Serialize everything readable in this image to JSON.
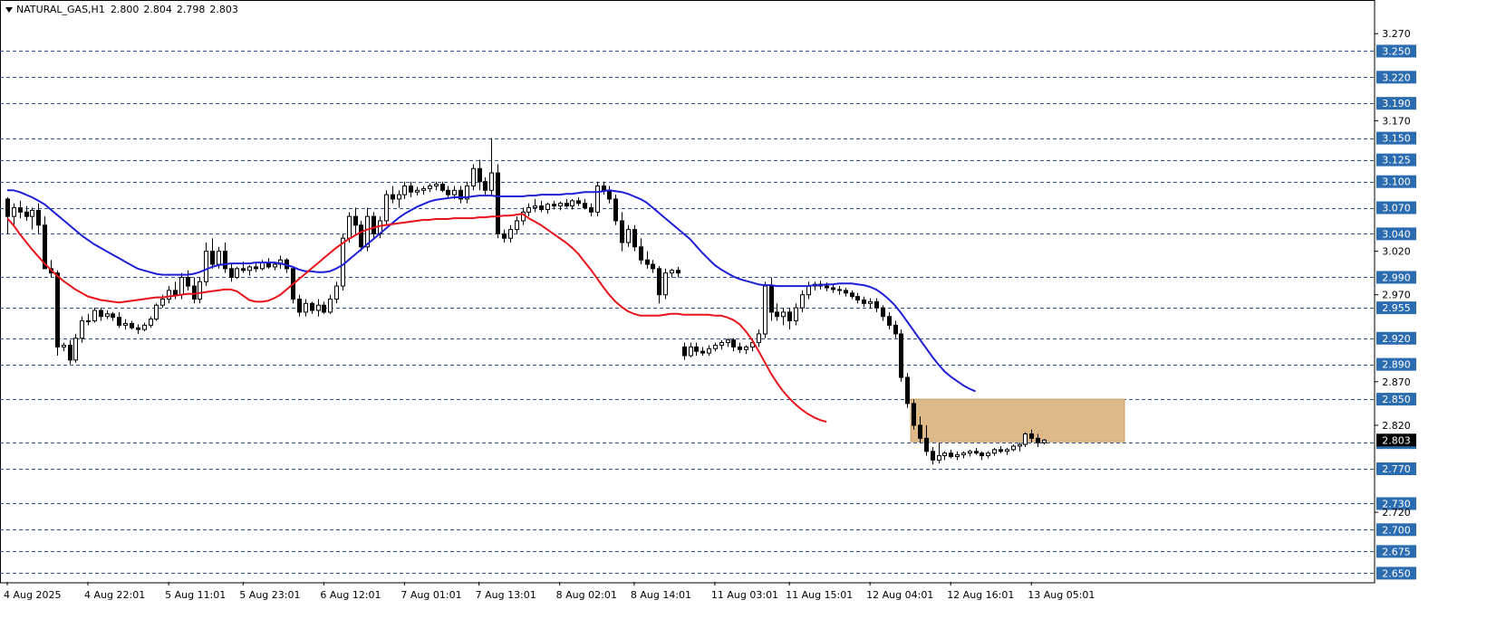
{
  "header": {
    "symbol": "NATURAL_GAS,H1",
    "open": "2.800",
    "high": "2.804",
    "low": "2.798",
    "close": "2.803"
  },
  "colors": {
    "background": "#ffffff",
    "grid": "#2f5597",
    "level_box": "#2b6cb0",
    "level_text": "#ffffff",
    "ma_fast": "#1f1fd6",
    "ma_slow": "#e8131b",
    "zone": "#ddb98a",
    "candle": "#000000",
    "axis_text": "#000000"
  },
  "chart_data": {
    "type": "candlestick",
    "instrument": "NATURAL_GAS",
    "timeframe": "H1",
    "ylim": [
      2.64,
      3.29
    ],
    "y_ticks": [
      "3.270",
      "3.250",
      "3.220",
      "3.190",
      "3.170",
      "3.150",
      "3.125",
      "3.100",
      "3.070",
      "3.040",
      "3.020",
      "2.990",
      "2.970",
      "2.955",
      "2.920",
      "2.890",
      "2.870",
      "2.850",
      "2.820",
      "2.800",
      "2.770",
      "2.730",
      "2.720",
      "2.700",
      "2.675",
      "2.650"
    ],
    "horizontal_levels": [
      "3.250",
      "3.220",
      "3.190",
      "3.150",
      "3.125",
      "3.100",
      "3.070",
      "3.040",
      "2.990",
      "2.955",
      "2.920",
      "2.890",
      "2.850",
      "2.800",
      "2.770",
      "2.730",
      "2.700",
      "2.675",
      "2.650"
    ],
    "current_price": "2.803",
    "x_labels": [
      "4 Aug 2025",
      "4 Aug 22:01",
      "5 Aug 11:01",
      "5 Aug 23:01",
      "6 Aug 12:01",
      "7 Aug 01:01",
      "7 Aug 13:01",
      "8 Aug 02:01",
      "8 Aug 14:01",
      "11 Aug 03:01",
      "11 Aug 15:01",
      "12 Aug 04:01",
      "12 Aug 16:01",
      "13 Aug 05:01"
    ],
    "x_label_candle_index": [
      0,
      13,
      26,
      38,
      51,
      64,
      76,
      89,
      101,
      114,
      126,
      139,
      152,
      165
    ],
    "zone": {
      "y_top": 2.85,
      "y_bottom": 2.801,
      "x_start_index": 146,
      "x_end_index": 180
    },
    "candles": [
      [
        3.08,
        3.082,
        3.04,
        3.06
      ],
      [
        3.06,
        3.075,
        3.05,
        3.07
      ],
      [
        3.07,
        3.078,
        3.058,
        3.065
      ],
      [
        3.065,
        3.072,
        3.055,
        3.06
      ],
      [
        3.06,
        3.07,
        3.045,
        3.067
      ],
      [
        3.067,
        3.075,
        3.04,
        3.05
      ],
      [
        3.05,
        3.06,
        3.0,
        3.0
      ],
      [
        3.0,
        3.01,
        2.99,
        2.995
      ],
      [
        2.995,
        2.998,
        2.9,
        2.91
      ],
      [
        2.91,
        2.915,
        2.905,
        2.912
      ],
      [
        2.912,
        2.918,
        2.89,
        2.895
      ],
      [
        2.895,
        2.925,
        2.892,
        2.92
      ],
      [
        2.92,
        2.945,
        2.915,
        2.94
      ],
      [
        2.94,
        2.948,
        2.935,
        2.94
      ],
      [
        2.94,
        2.955,
        2.938,
        2.952
      ],
      [
        2.952,
        2.955,
        2.94,
        2.945
      ],
      [
        2.945,
        2.952,
        2.942,
        2.948
      ],
      [
        2.948,
        2.95,
        2.94,
        2.944
      ],
      [
        2.944,
        2.95,
        2.932,
        2.935
      ],
      [
        2.935,
        2.942,
        2.93,
        2.937
      ],
      [
        2.937,
        2.94,
        2.93,
        2.932
      ],
      [
        2.932,
        2.936,
        2.925,
        2.93
      ],
      [
        2.93,
        2.938,
        2.928,
        2.935
      ],
      [
        2.935,
        2.945,
        2.932,
        2.942
      ],
      [
        2.942,
        2.96,
        2.94,
        2.958
      ],
      [
        2.958,
        2.97,
        2.955,
        2.965
      ],
      [
        2.965,
        2.98,
        2.96,
        2.975
      ],
      [
        2.975,
        2.985,
        2.965,
        2.97
      ],
      [
        2.97,
        2.995,
        2.965,
        2.99
      ],
      [
        2.99,
        2.998,
        2.975,
        2.98
      ],
      [
        2.98,
        2.99,
        2.96,
        2.965
      ],
      [
        2.965,
        2.99,
        2.96,
        2.985
      ],
      [
        2.985,
        3.03,
        2.98,
        3.02
      ],
      [
        3.02,
        3.035,
        3.0,
        3.005
      ],
      [
        3.005,
        3.025,
        3.0,
        3.02
      ],
      [
        3.02,
        3.03,
        2.995,
        3.0
      ],
      [
        3.0,
        3.005,
        2.985,
        2.99
      ],
      [
        2.99,
        3.002,
        2.988,
        3.0
      ],
      [
        3.0,
        3.008,
        2.995,
        2.998
      ],
      [
        2.998,
        3.004,
        2.992,
        3.002
      ],
      [
        3.002,
        3.006,
        2.996,
        3.0
      ],
      [
        3.0,
        3.01,
        2.998,
        3.007
      ],
      [
        3.007,
        3.012,
        3.0,
        3.002
      ],
      [
        3.002,
        3.008,
        2.998,
        3.005
      ],
      [
        3.005,
        3.015,
        3.0,
        3.01
      ],
      [
        3.01,
        3.012,
        2.995,
        3.0
      ],
      [
        3.0,
        3.002,
        2.96,
        2.965
      ],
      [
        2.965,
        2.97,
        2.945,
        2.95
      ],
      [
        2.95,
        2.965,
        2.945,
        2.96
      ],
      [
        2.96,
        2.962,
        2.948,
        2.952
      ],
      [
        2.952,
        2.965,
        2.945,
        2.958
      ],
      [
        2.958,
        2.962,
        2.948,
        2.95
      ],
      [
        2.95,
        2.97,
        2.948,
        2.965
      ],
      [
        2.965,
        2.985,
        2.96,
        2.98
      ],
      [
        2.98,
        3.04,
        2.975,
        3.035
      ],
      [
        3.035,
        3.065,
        3.03,
        3.06
      ],
      [
        3.06,
        3.07,
        3.04,
        3.05
      ],
      [
        3.05,
        3.055,
        3.02,
        3.025
      ],
      [
        3.025,
        3.07,
        3.02,
        3.06
      ],
      [
        3.06,
        3.065,
        3.035,
        3.04
      ],
      [
        3.04,
        3.06,
        3.035,
        3.055
      ],
      [
        3.055,
        3.09,
        3.05,
        3.085
      ],
      [
        3.085,
        3.095,
        3.075,
        3.08
      ],
      [
        3.08,
        3.09,
        3.07,
        3.085
      ],
      [
        3.085,
        3.1,
        3.08,
        3.095
      ],
      [
        3.095,
        3.1,
        3.082,
        3.088
      ],
      [
        3.088,
        3.094,
        3.084,
        3.09
      ],
      [
        3.09,
        3.095,
        3.085,
        3.092
      ],
      [
        3.092,
        3.098,
        3.088,
        3.095
      ],
      [
        3.095,
        3.1,
        3.09,
        3.097
      ],
      [
        3.097,
        3.1,
        3.088,
        3.09
      ],
      [
        3.09,
        3.095,
        3.08,
        3.085
      ],
      [
        3.085,
        3.095,
        3.08,
        3.09
      ],
      [
        3.09,
        3.095,
        3.075,
        3.08
      ],
      [
        3.08,
        3.1,
        3.075,
        3.095
      ],
      [
        3.095,
        3.12,
        3.09,
        3.115
      ],
      [
        3.115,
        3.125,
        3.09,
        3.1
      ],
      [
        3.1,
        3.105,
        3.085,
        3.09
      ],
      [
        3.09,
        3.15,
        3.085,
        3.11
      ],
      [
        3.11,
        3.12,
        3.035,
        3.04
      ],
      [
        3.04,
        3.045,
        3.03,
        3.035
      ],
      [
        3.035,
        3.05,
        3.03,
        3.045
      ],
      [
        3.045,
        3.06,
        3.04,
        3.055
      ],
      [
        3.055,
        3.07,
        3.05,
        3.065
      ],
      [
        3.065,
        3.075,
        3.06,
        3.07
      ],
      [
        3.07,
        3.08,
        3.065,
        3.072
      ],
      [
        3.072,
        3.078,
        3.065,
        3.068
      ],
      [
        3.068,
        3.076,
        3.063,
        3.074
      ],
      [
        3.074,
        3.078,
        3.068,
        3.072
      ],
      [
        3.072,
        3.077,
        3.067,
        3.075
      ],
      [
        3.075,
        3.08,
        3.07,
        3.072
      ],
      [
        3.072,
        3.08,
        3.068,
        3.078
      ],
      [
        3.078,
        3.082,
        3.072,
        3.075
      ],
      [
        3.075,
        3.08,
        3.068,
        3.07
      ],
      [
        3.07,
        3.075,
        3.06,
        3.065
      ],
      [
        3.065,
        3.1,
        3.06,
        3.095
      ],
      [
        3.095,
        3.1,
        3.085,
        3.09
      ],
      [
        3.09,
        3.095,
        3.075,
        3.08
      ],
      [
        3.08,
        3.085,
        3.05,
        3.055
      ],
      [
        3.055,
        3.065,
        3.02,
        3.03
      ],
      [
        3.03,
        3.05,
        3.025,
        3.045
      ],
      [
        3.045,
        3.05,
        3.02,
        3.025
      ],
      [
        3.025,
        3.035,
        3.005,
        3.01
      ],
      [
        3.01,
        3.02,
        3.0,
        3.005
      ],
      [
        3.005,
        3.01,
        2.995,
        3.0
      ],
      [
        3.0,
        3.003,
        2.96,
        2.97
      ],
      [
        2.97,
        3.0,
        2.965,
        2.995
      ],
      [
        2.995,
        3.0,
        2.99,
        2.998
      ],
      [
        2.998,
        3.002,
        2.99,
        2.995
      ],
      [
        2.91,
        2.915,
        2.895,
        2.9
      ],
      [
        2.9,
        2.915,
        2.898,
        2.91
      ],
      [
        2.91,
        2.915,
        2.9,
        2.905
      ],
      [
        2.905,
        2.91,
        2.9,
        2.903
      ],
      [
        2.903,
        2.912,
        2.9,
        2.908
      ],
      [
        2.908,
        2.915,
        2.905,
        2.912
      ],
      [
        2.912,
        2.918,
        2.907,
        2.915
      ],
      [
        2.915,
        2.92,
        2.91,
        2.918
      ],
      [
        2.918,
        2.92,
        2.905,
        2.91
      ],
      [
        2.91,
        2.915,
        2.903,
        2.907
      ],
      [
        2.907,
        2.912,
        2.902,
        2.91
      ],
      [
        2.91,
        2.92,
        2.905,
        2.915
      ],
      [
        2.915,
        2.93,
        2.91,
        2.925
      ],
      [
        2.925,
        2.985,
        2.92,
        2.98
      ],
      [
        2.98,
        2.99,
        2.94,
        2.95
      ],
      [
        2.95,
        2.96,
        2.94,
        2.945
      ],
      [
        2.945,
        2.955,
        2.935,
        2.95
      ],
      [
        2.95,
        2.955,
        2.93,
        2.94
      ],
      [
        2.94,
        2.96,
        2.935,
        2.955
      ],
      [
        2.955,
        2.975,
        2.95,
        2.97
      ],
      [
        2.97,
        2.985,
        2.965,
        2.98
      ],
      [
        2.98,
        2.985,
        2.975,
        2.982
      ],
      [
        2.982,
        2.986,
        2.976,
        2.98
      ],
      [
        2.98,
        2.984,
        2.974,
        2.978
      ],
      [
        2.978,
        2.982,
        2.972,
        2.976
      ],
      [
        2.976,
        2.98,
        2.97,
        2.975
      ],
      [
        2.975,
        2.978,
        2.968,
        2.972
      ],
      [
        2.972,
        2.975,
        2.965,
        2.968
      ],
      [
        2.968,
        2.972,
        2.96,
        2.964
      ],
      [
        2.964,
        2.968,
        2.956,
        2.96
      ],
      [
        2.96,
        2.966,
        2.954,
        2.962
      ],
      [
        2.962,
        2.966,
        2.95,
        2.955
      ],
      [
        2.955,
        2.958,
        2.94,
        2.945
      ],
      [
        2.945,
        2.95,
        2.93,
        2.935
      ],
      [
        2.935,
        2.94,
        2.92,
        2.925
      ],
      [
        2.925,
        2.93,
        2.87,
        2.875
      ],
      [
        2.875,
        2.88,
        2.84,
        2.845
      ],
      [
        2.845,
        2.85,
        2.815,
        2.82
      ],
      [
        2.82,
        2.83,
        2.8,
        2.805
      ],
      [
        2.805,
        2.82,
        2.785,
        2.79
      ],
      [
        2.79,
        2.795,
        2.775,
        2.78
      ],
      [
        2.78,
        2.8,
        2.776,
        2.785
      ],
      [
        2.785,
        2.79,
        2.78,
        2.788
      ],
      [
        2.788,
        2.792,
        2.782,
        2.784
      ],
      [
        2.784,
        2.79,
        2.78,
        2.786
      ],
      [
        2.786,
        2.79,
        2.782,
        2.788
      ],
      [
        2.788,
        2.792,
        2.784,
        2.79
      ],
      [
        2.79,
        2.794,
        2.786,
        2.788
      ],
      [
        2.788,
        2.79,
        2.78,
        2.785
      ],
      [
        2.785,
        2.79,
        2.782,
        2.788
      ],
      [
        2.788,
        2.794,
        2.785,
        2.792
      ],
      [
        2.792,
        2.796,
        2.788,
        2.79
      ],
      [
        2.79,
        2.794,
        2.786,
        2.792
      ],
      [
        2.792,
        2.798,
        2.79,
        2.796
      ],
      [
        2.796,
        2.8,
        2.79,
        2.798
      ],
      [
        2.798,
        2.812,
        2.795,
        2.81
      ],
      [
        2.81,
        2.815,
        2.8,
        2.805
      ],
      [
        2.805,
        2.81,
        2.795,
        2.8
      ],
      [
        2.8,
        2.804,
        2.798,
        2.803
      ]
    ],
    "series": [
      {
        "kind": "moving_average",
        "color": "blue",
        "values": [
          3.09,
          3.09,
          3.088,
          3.085,
          3.082,
          3.078,
          3.074,
          3.068,
          3.062,
          3.056,
          3.05,
          3.044,
          3.038,
          3.033,
          3.028,
          3.024,
          3.02,
          3.016,
          3.012,
          3.008,
          3.004,
          3.0,
          2.998,
          2.996,
          2.994,
          2.993,
          2.993,
          2.993,
          2.993,
          2.993,
          2.994,
          2.996,
          2.999,
          3.002,
          3.004,
          3.005,
          3.006,
          3.006,
          3.006,
          3.006,
          3.007,
          3.007,
          3.007,
          3.007,
          3.006,
          3.004,
          3.002,
          2.999,
          2.997,
          2.997,
          2.996,
          2.996,
          2.997,
          3.0,
          3.004,
          3.01,
          3.016,
          3.022,
          3.028,
          3.034,
          3.04,
          3.046,
          3.052,
          3.058,
          3.063,
          3.067,
          3.071,
          3.074,
          3.077,
          3.079,
          3.08,
          3.081,
          3.082,
          3.082,
          3.082,
          3.083,
          3.084,
          3.084,
          3.084,
          3.083,
          3.083,
          3.083,
          3.083,
          3.083,
          3.084,
          3.084,
          3.085,
          3.085,
          3.085,
          3.085,
          3.086,
          3.086,
          3.087,
          3.088,
          3.088,
          3.088,
          3.089,
          3.09,
          3.089,
          3.088,
          3.086,
          3.083,
          3.08,
          3.076,
          3.07,
          3.064,
          3.058,
          3.052,
          3.046,
          3.04,
          3.034,
          3.026,
          3.018,
          3.011,
          3.004,
          2.999,
          2.995,
          2.991,
          2.988,
          2.986,
          2.984,
          2.982,
          2.981,
          2.981,
          2.98,
          2.98,
          2.98,
          2.98,
          2.98,
          2.98,
          2.981,
          2.981,
          2.982,
          2.982,
          2.983,
          2.983,
          2.983,
          2.982,
          2.981,
          2.979,
          2.976,
          2.971,
          2.965,
          2.958,
          2.949,
          2.939,
          2.929,
          2.919,
          2.909,
          2.899,
          2.89,
          2.882,
          2.876,
          2.871,
          2.866,
          2.862,
          2.859
        ]
      },
      {
        "kind": "moving_average",
        "color": "red",
        "values": [
          3.058,
          3.05,
          3.04,
          3.031,
          3.022,
          3.014,
          3.006,
          2.999,
          2.992,
          2.986,
          2.981,
          2.976,
          2.972,
          2.968,
          2.966,
          2.964,
          2.963,
          2.962,
          2.961,
          2.962,
          2.963,
          2.964,
          2.965,
          2.966,
          2.967,
          2.967,
          2.968,
          2.969,
          2.97,
          2.971,
          2.971,
          2.972,
          2.973,
          2.974,
          2.975,
          2.976,
          2.976,
          2.974,
          2.969,
          2.964,
          2.962,
          2.962,
          2.963,
          2.966,
          2.97,
          2.976,
          2.982,
          2.988,
          2.994,
          3.0,
          3.006,
          3.012,
          3.018,
          3.024,
          3.029,
          3.034,
          3.038,
          3.042,
          3.045,
          3.047,
          3.049,
          3.05,
          3.051,
          3.052,
          3.053,
          3.054,
          3.055,
          3.056,
          3.056,
          3.057,
          3.057,
          3.057,
          3.058,
          3.058,
          3.058,
          3.058,
          3.059,
          3.059,
          3.06,
          3.06,
          3.061,
          3.061,
          3.062,
          3.063,
          3.058,
          3.054,
          3.05,
          3.045,
          3.04,
          3.035,
          3.03,
          3.024,
          3.017,
          3.008,
          2.999,
          2.989,
          2.979,
          2.97,
          2.962,
          2.956,
          2.951,
          2.948,
          2.946,
          2.946,
          2.946,
          2.946,
          2.947,
          2.948,
          2.948,
          2.947,
          2.947,
          2.947,
          2.947,
          2.947,
          2.946,
          2.946,
          2.944,
          2.941,
          2.936,
          2.928,
          2.918,
          2.906,
          2.893,
          2.88,
          2.869,
          2.859,
          2.851,
          2.844,
          2.838,
          2.833,
          2.829,
          2.826,
          2.824
        ]
      }
    ]
  }
}
